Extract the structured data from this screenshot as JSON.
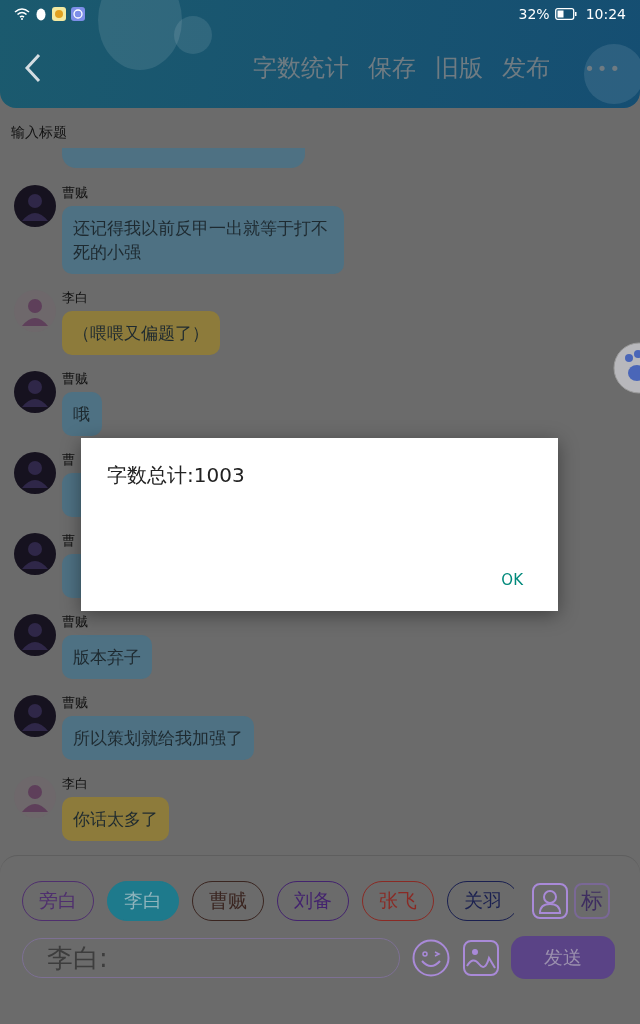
{
  "status_bar": {
    "battery": "32%",
    "time": "10:24"
  },
  "toolbar": {
    "actions": [
      "字数统计",
      "保存",
      "旧版",
      "发布"
    ],
    "more": "•••"
  },
  "title_field": {
    "placeholder": "输入标题"
  },
  "messages": [
    {
      "kind": "cut",
      "color": "#4e7183"
    },
    {
      "kind": "message",
      "name": "曹贼",
      "text": "还记得我以前反甲一出就等于打不死的小强",
      "color": "#4e7183"
    },
    {
      "kind": "message",
      "name": "李白",
      "text": "（喂喂又偏题了）",
      "color": "#8d7b3b"
    },
    {
      "kind": "message",
      "name": "曹贼",
      "text": "哦",
      "color": "#4e7183"
    },
    {
      "kind": "message",
      "name": "曹",
      "color": "#4e7183"
    },
    {
      "kind": "message",
      "name": "曹",
      "color": "#4e7183"
    },
    {
      "kind": "message",
      "name": "曹贼",
      "text": "版本弃子",
      "color": "#4e7183"
    },
    {
      "kind": "message",
      "name": "曹贼",
      "text": "所以策划就给我加强了",
      "color": "#4e7183"
    },
    {
      "kind": "message",
      "name": "李白",
      "text": "你话太多了",
      "color": "#8d7b3b"
    }
  ],
  "roles": [
    {
      "label": "旁白",
      "color": "#4f2f6e",
      "selected": false
    },
    {
      "label": "李白",
      "color": "#1e7a8c",
      "selected": true
    },
    {
      "label": "曹贼",
      "color": "#3a2520",
      "selected": false
    },
    {
      "label": "刘备",
      "color": "#43236e",
      "selected": false
    },
    {
      "label": "张飞",
      "color": "#8a2a24",
      "selected": false
    },
    {
      "label": "关羽",
      "color": "#1a2050",
      "selected": false
    }
  ],
  "mark_button": "标",
  "input": {
    "placeholder": "李白:"
  },
  "send_button": "发送",
  "dialog": {
    "message": "字数总计:1003",
    "ok": "OK"
  }
}
